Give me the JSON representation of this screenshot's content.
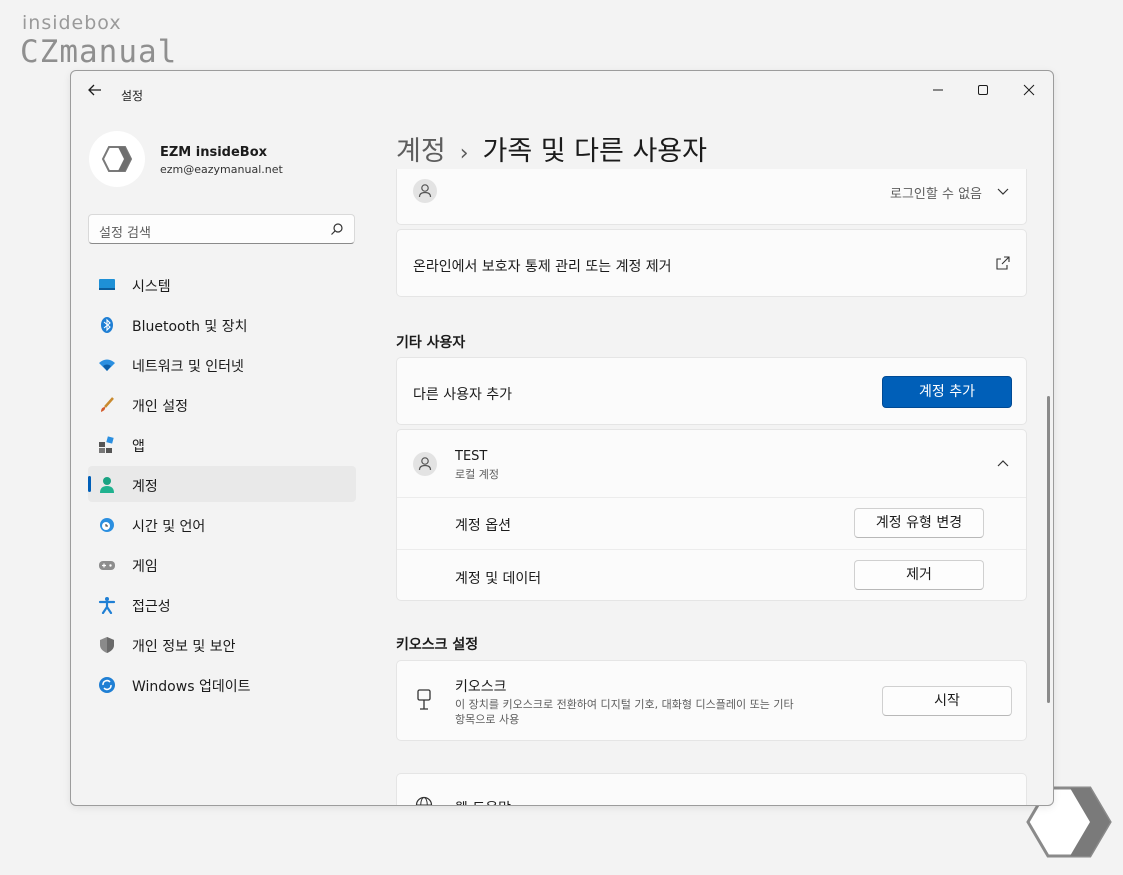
{
  "watermark": {
    "line1": "insidebox",
    "line2": "CZmanual"
  },
  "window": {
    "title": "설정"
  },
  "user": {
    "name": "EZM insideBox",
    "email": "ezm@eazymanual.net"
  },
  "search": {
    "placeholder": "설정 검색"
  },
  "nav": {
    "items": [
      {
        "label": "시스템",
        "icon": "system-icon"
      },
      {
        "label": "Bluetooth 및 장치",
        "icon": "bluetooth-icon"
      },
      {
        "label": "네트워크 및 인터넷",
        "icon": "wifi-icon"
      },
      {
        "label": "개인 설정",
        "icon": "brush-icon"
      },
      {
        "label": "앱",
        "icon": "apps-icon"
      },
      {
        "label": "계정",
        "icon": "account-icon",
        "active": true
      },
      {
        "label": "시간 및 언어",
        "icon": "clock-globe-icon"
      },
      {
        "label": "게임",
        "icon": "gamepad-icon"
      },
      {
        "label": "접근성",
        "icon": "accessibility-icon"
      },
      {
        "label": "개인 정보 및 보안",
        "icon": "shield-icon"
      },
      {
        "label": "Windows 업데이트",
        "icon": "update-icon"
      }
    ]
  },
  "breadcrumb": {
    "parent": "계정",
    "separator": "›",
    "current": "가족 및 다른 사용자"
  },
  "family": {
    "member_status": "로그인할 수 없음",
    "manage_online": "온라인에서 보호자 통제 관리 또는 계정 제거"
  },
  "other_users": {
    "title": "기타 사용자",
    "add_label": "다른 사용자 추가",
    "add_button": "계정 추가",
    "user": {
      "name": "TEST",
      "type": "로컬 계정",
      "options_label": "계정 옵션",
      "options_button": "계정 유형 변경",
      "data_label": "계정 및 데이터",
      "data_button": "제거"
    }
  },
  "kiosk": {
    "title": "키오스크 설정",
    "name": "키오스크",
    "description_line1": "이 장치를 키오스크로 전환하여 디지털 기호, 대화형 디스플레이 또는 기타",
    "description_line2": "항목으로 사용",
    "button": "시작"
  },
  "help": {
    "label": "웹 도움말"
  },
  "colors": {
    "accent": "#005fb8",
    "background": "#f3f3f3",
    "card": "#fbfbfb"
  }
}
